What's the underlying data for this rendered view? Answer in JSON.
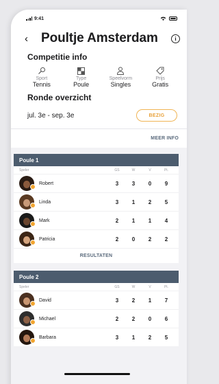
{
  "status_bar": {
    "time": "9:41"
  },
  "header": {
    "title": "Poultje Amsterdam"
  },
  "competition_info": {
    "title": "Competitie info",
    "items": [
      {
        "icon": "racket-icon",
        "label": "Sport",
        "value": "Tennis"
      },
      {
        "icon": "bracket-icon",
        "label": "Type",
        "value": "Poule"
      },
      {
        "icon": "person-icon",
        "label": "Speelvorm",
        "value": "Singles"
      },
      {
        "icon": "tag-icon",
        "label": "Prijs",
        "value": "Gratis"
      }
    ]
  },
  "round_overview": {
    "title": "Ronde overzicht",
    "dates": "jul. 3e - sep. 3e",
    "status": "BEZIG",
    "more_info": "MEER INFO"
  },
  "columns": {
    "player": "Speler",
    "gs": "GS",
    "w": "W",
    "v": "V",
    "pt": "Pt."
  },
  "poules": [
    {
      "name": "Poule 1",
      "players": [
        {
          "name": "Robert",
          "gs": "3",
          "w": "3",
          "v": "0",
          "pt": "9",
          "skin": "#8a5a3c",
          "hair": "#2a1c14"
        },
        {
          "name": "Linda",
          "gs": "3",
          "w": "1",
          "v": "2",
          "pt": "5",
          "skin": "#c89a78",
          "hair": "#5a3a22"
        },
        {
          "name": "Mark",
          "gs": "2",
          "w": "1",
          "v": "1",
          "pt": "4",
          "skin": "#6a4630",
          "hair": "#1a1a1a"
        },
        {
          "name": "Patricia",
          "gs": "2",
          "w": "0",
          "v": "2",
          "pt": "2",
          "skin": "#d4a47e",
          "hair": "#3c2616"
        }
      ],
      "results_label": "RESULTATEN"
    },
    {
      "name": "Poule 2",
      "players": [
        {
          "name": "David",
          "gs": "3",
          "w": "2",
          "v": "1",
          "pt": "7",
          "skin": "#c99672",
          "hair": "#4a3020"
        },
        {
          "name": "Michael",
          "gs": "2",
          "w": "2",
          "v": "0",
          "pt": "6",
          "skin": "#8c6046",
          "hair": "#2e2e2e"
        },
        {
          "name": "Barbara",
          "gs": "3",
          "w": "1",
          "v": "2",
          "pt": "5",
          "skin": "#b27a58",
          "hair": "#24160e"
        }
      ]
    }
  ],
  "colors": {
    "poule_header": "#4c5c6e",
    "accent": "#f0b454",
    "link": "#5a6a7c",
    "avatar_badge": "#f2a530"
  }
}
